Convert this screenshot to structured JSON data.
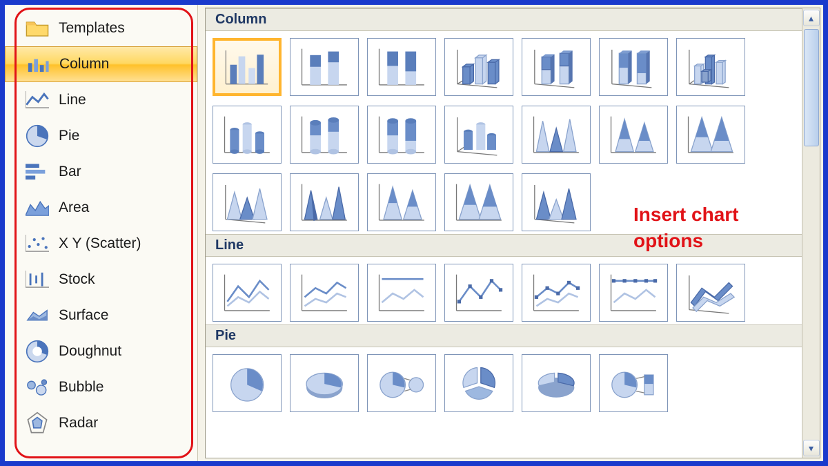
{
  "sidebar": {
    "items": [
      {
        "label": "Templates",
        "icon": "folder-icon"
      },
      {
        "label": "Column",
        "icon": "column-chart-icon",
        "selected": true
      },
      {
        "label": "Line",
        "icon": "line-chart-icon"
      },
      {
        "label": "Pie",
        "icon": "pie-chart-icon"
      },
      {
        "label": "Bar",
        "icon": "bar-chart-icon"
      },
      {
        "label": "Area",
        "icon": "area-chart-icon"
      },
      {
        "label": "X Y (Scatter)",
        "icon": "scatter-chart-icon"
      },
      {
        "label": "Stock",
        "icon": "stock-chart-icon"
      },
      {
        "label": "Surface",
        "icon": "surface-chart-icon"
      },
      {
        "label": "Doughnut",
        "icon": "doughnut-chart-icon"
      },
      {
        "label": "Bubble",
        "icon": "bubble-chart-icon"
      },
      {
        "label": "Radar",
        "icon": "radar-chart-icon"
      }
    ]
  },
  "main": {
    "sections": {
      "column": {
        "header": "Column"
      },
      "line": {
        "header": "Line"
      },
      "pie": {
        "header": "Pie"
      }
    },
    "annotation": "Insert chart\noptions"
  }
}
